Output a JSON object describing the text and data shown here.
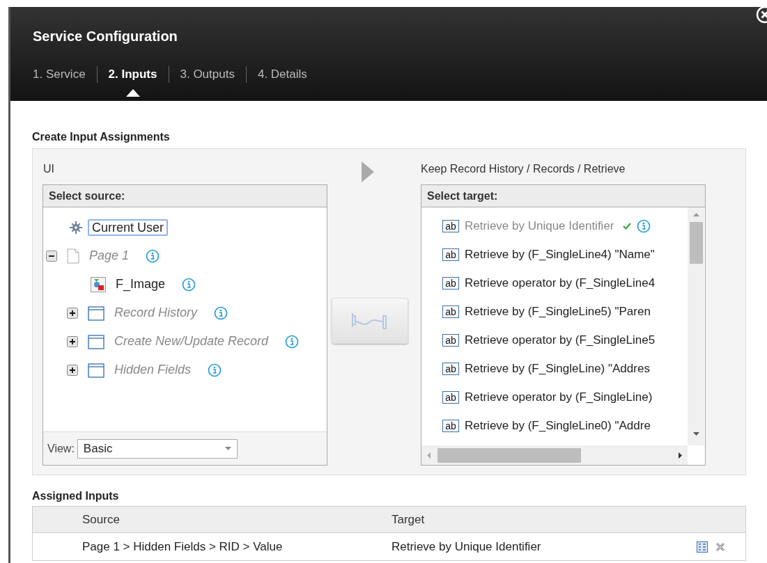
{
  "window": {
    "title": "Service Configuration"
  },
  "tabs": [
    {
      "label": "1. Service",
      "selected": false
    },
    {
      "label": "2. Inputs",
      "selected": true
    },
    {
      "label": "3. Outputs",
      "selected": false
    },
    {
      "label": "4. Details",
      "selected": false
    }
  ],
  "assignments": {
    "title": "Create Input Assignments",
    "source": {
      "context": "UI",
      "header": "Select source:",
      "tree": [
        {
          "label": "Current User",
          "kind": "user",
          "selected": true,
          "info": false
        },
        {
          "label": "Page 1",
          "kind": "page",
          "selected": false,
          "info": true,
          "expanded": true,
          "children": [
            {
              "label": "F_Image",
              "kind": "image",
              "selected": false,
              "info": true
            },
            {
              "label": "Record History",
              "kind": "section",
              "selected": false,
              "info": true,
              "expanded": false
            },
            {
              "label": "Create New/Update Record",
              "kind": "section",
              "selected": false,
              "info": true,
              "expanded": false
            },
            {
              "label": "Hidden Fields",
              "kind": "section",
              "selected": false,
              "info": true,
              "expanded": false
            }
          ]
        }
      ],
      "view_label": "View:",
      "view_value": "Basic"
    },
    "target": {
      "context": "Keep Record History / Records / Retrieve",
      "header": "Select target:",
      "items": [
        {
          "icon": "ab",
          "label": "Retrieve by Unique Identifier",
          "assigned": true,
          "info": true
        },
        {
          "icon": "ab",
          "label": "Retrieve by (F_SingleLine4) \"Name\"",
          "assigned": false,
          "info": false
        },
        {
          "icon": "ab",
          "label": "Retrieve operator by (F_SingleLine4",
          "assigned": false,
          "info": false
        },
        {
          "icon": "ab",
          "label": "Retrieve by (F_SingleLine5) \"Paren",
          "assigned": false,
          "info": false
        },
        {
          "icon": "ab",
          "label": "Retrieve operator by (F_SingleLine5",
          "assigned": false,
          "info": false
        },
        {
          "icon": "ab",
          "label": "Retrieve by (F_SingleLine) \"Addres",
          "assigned": false,
          "info": false
        },
        {
          "icon": "ab",
          "label": "Retrieve operator by (F_SingleLine)",
          "assigned": false,
          "info": false
        },
        {
          "icon": "ab",
          "label": "Retrieve by (F_SingleLine0) \"Addre",
          "assigned": false,
          "info": false
        }
      ]
    }
  },
  "assigned_inputs": {
    "title": "Assigned Inputs",
    "columns": [
      "Source",
      "Target"
    ],
    "rows": [
      {
        "source": "Page 1 > Hidden Fields > RID > Value",
        "target": "Retrieve by Unique Identifier"
      }
    ]
  }
}
